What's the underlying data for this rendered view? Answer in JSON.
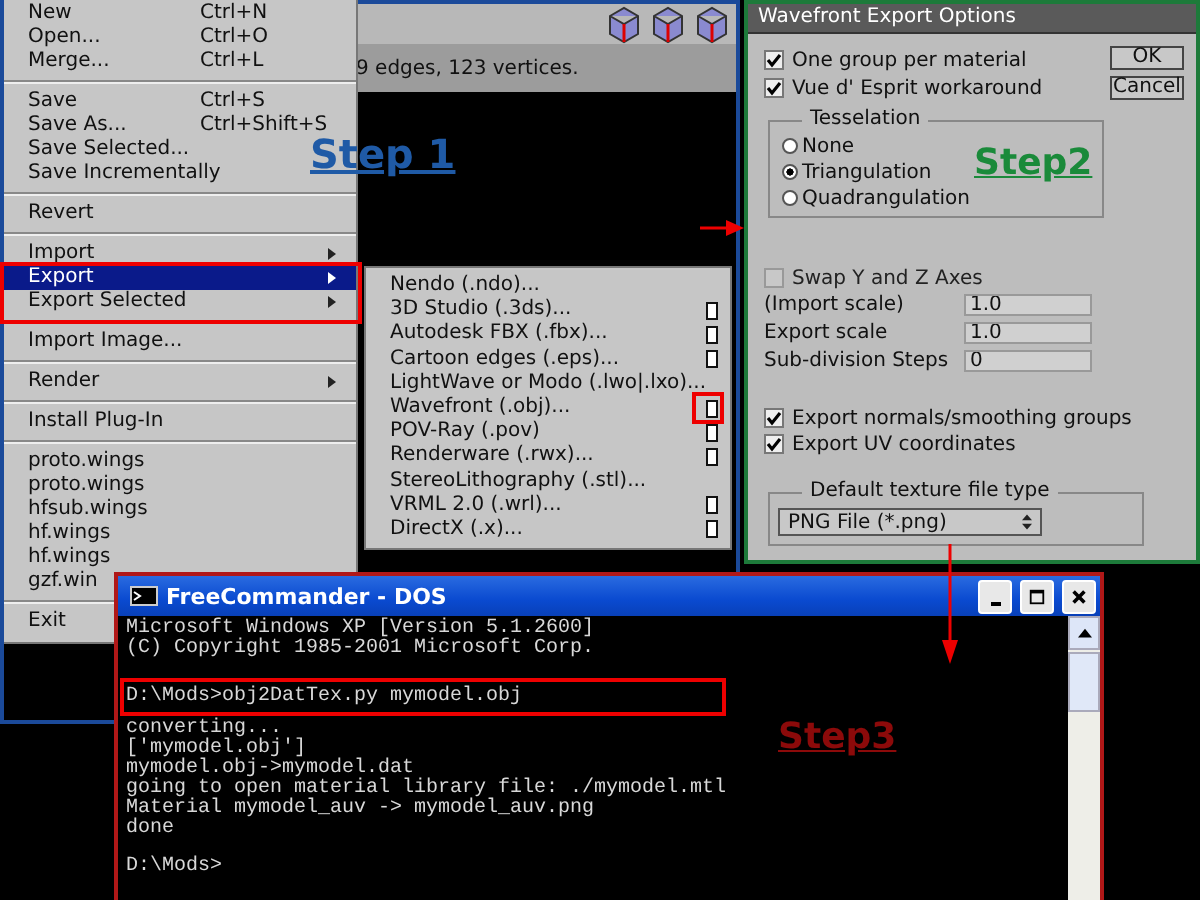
{
  "modeler": {
    "status": "9 edges, 123 vertices.",
    "step_label": "Step 1",
    "file_menu": [
      {
        "kind": "item",
        "label": "New",
        "shortcut": "Ctrl+N",
        "selected": false,
        "submenu": false
      },
      {
        "kind": "item",
        "label": "Open...",
        "shortcut": "Ctrl+O",
        "selected": false,
        "submenu": false
      },
      {
        "kind": "item",
        "label": "Merge...",
        "shortcut": "Ctrl+L",
        "selected": false,
        "submenu": false
      },
      {
        "kind": "separator"
      },
      {
        "kind": "item",
        "label": "Save",
        "shortcut": "Ctrl+S",
        "selected": false,
        "submenu": false
      },
      {
        "kind": "item",
        "label": "Save As...",
        "shortcut": "Ctrl+Shift+S",
        "selected": false,
        "submenu": false
      },
      {
        "kind": "item",
        "label": "Save Selected...",
        "selected": false,
        "submenu": false
      },
      {
        "kind": "item",
        "label": "Save Incrementally",
        "selected": false,
        "submenu": false
      },
      {
        "kind": "separator"
      },
      {
        "kind": "item",
        "label": "Revert",
        "selected": false,
        "submenu": false
      },
      {
        "kind": "separator"
      },
      {
        "kind": "item",
        "label": "Import",
        "selected": false,
        "submenu": true
      },
      {
        "kind": "item",
        "label": "Export",
        "selected": true,
        "submenu": true
      },
      {
        "kind": "item",
        "label": "Export Selected",
        "selected": false,
        "submenu": true
      },
      {
        "kind": "separator"
      },
      {
        "kind": "item",
        "label": "Import Image...",
        "selected": false,
        "submenu": false
      },
      {
        "kind": "separator"
      },
      {
        "kind": "item",
        "label": "Render",
        "selected": false,
        "submenu": true
      },
      {
        "kind": "separator"
      },
      {
        "kind": "item",
        "label": "Install Plug-In",
        "selected": false,
        "submenu": false
      },
      {
        "kind": "separator"
      },
      {
        "kind": "item",
        "label": "proto.wings",
        "selected": false,
        "submenu": false
      },
      {
        "kind": "item",
        "label": "proto.wings",
        "selected": false,
        "submenu": false
      },
      {
        "kind": "item",
        "label": "hfsub.wings",
        "selected": false,
        "submenu": false
      },
      {
        "kind": "item",
        "label": "hf.wings",
        "selected": false,
        "submenu": false
      },
      {
        "kind": "item",
        "label": "hf.wings",
        "selected": false,
        "submenu": false
      },
      {
        "kind": "item",
        "label": "gzf.win",
        "selected": false,
        "submenu": false
      },
      {
        "kind": "separator"
      },
      {
        "kind": "item",
        "label": "Exit",
        "selected": false,
        "submenu": false
      }
    ],
    "export_submenu": [
      {
        "label": "Nendo (.ndo)...",
        "options": false
      },
      {
        "label": "3D Studio (.3ds)...",
        "options": true
      },
      {
        "label": "Autodesk FBX (.fbx)...",
        "options": true
      },
      {
        "label": "Cartoon edges (.eps)...",
        "options": true
      },
      {
        "label": "LightWave or Modo (.lwo|.lxo)...",
        "options": false
      },
      {
        "label": "Wavefront (.obj)...",
        "options": true
      },
      {
        "label": "POV-Ray (.pov)",
        "options": true
      },
      {
        "label": "Renderware (.rwx)...",
        "options": true
      },
      {
        "label": "StereoLithography (.stl)...",
        "options": false
      },
      {
        "label": "VRML 2.0 (.wrl)...",
        "options": true
      },
      {
        "label": "DirectX (.x)...",
        "options": true
      }
    ]
  },
  "export_dialog": {
    "title": "Wavefront Export Options",
    "step_label": "Step2",
    "top_options": [
      {
        "label": "One group per material",
        "checked": true
      },
      {
        "label": "Vue d' Esprit workaround",
        "checked": true
      }
    ],
    "buttons": [
      "OK",
      "Cancel"
    ],
    "tesselation": {
      "title": "Tesselation",
      "options": [
        {
          "label": "None",
          "selected": false
        },
        {
          "label": "Triangulation",
          "selected": true
        },
        {
          "label": "Quadrangulation",
          "selected": false
        }
      ]
    },
    "swap_axes": {
      "label": "Swap Y and Z Axes",
      "checked": false
    },
    "fields": [
      {
        "label": "(Import scale)",
        "value": "1.0"
      },
      {
        "label": "Export scale",
        "value": "1.0"
      },
      {
        "label": "Sub-division Steps",
        "value": "0"
      }
    ],
    "bottom_options": [
      {
        "label": "Export normals/smoothing groups",
        "checked": true
      },
      {
        "label": "Export UV coordinates",
        "checked": true
      }
    ],
    "texture": {
      "title": "Default texture file type",
      "value": "PNG File (*.png)"
    }
  },
  "console": {
    "title": "FreeCommander - DOS",
    "step_label": "Step3",
    "blocks": [
      [
        "Microsoft Windows XP [Version 5.1.2600]",
        "(C) Copyright 1985-2001 Microsoft Corp."
      ],
      [
        "D:\\Mods>obj2DatTex.py mymodel.obj",
        "converting...",
        "['mymodel.obj']",
        "mymodel.obj->mymodel.dat",
        "going to open material library file: ./mymodel.mtl",
        "Material mymodel_auv -> mymodel_auv.png",
        "done"
      ],
      [
        "D:\\Mods>"
      ]
    ]
  }
}
